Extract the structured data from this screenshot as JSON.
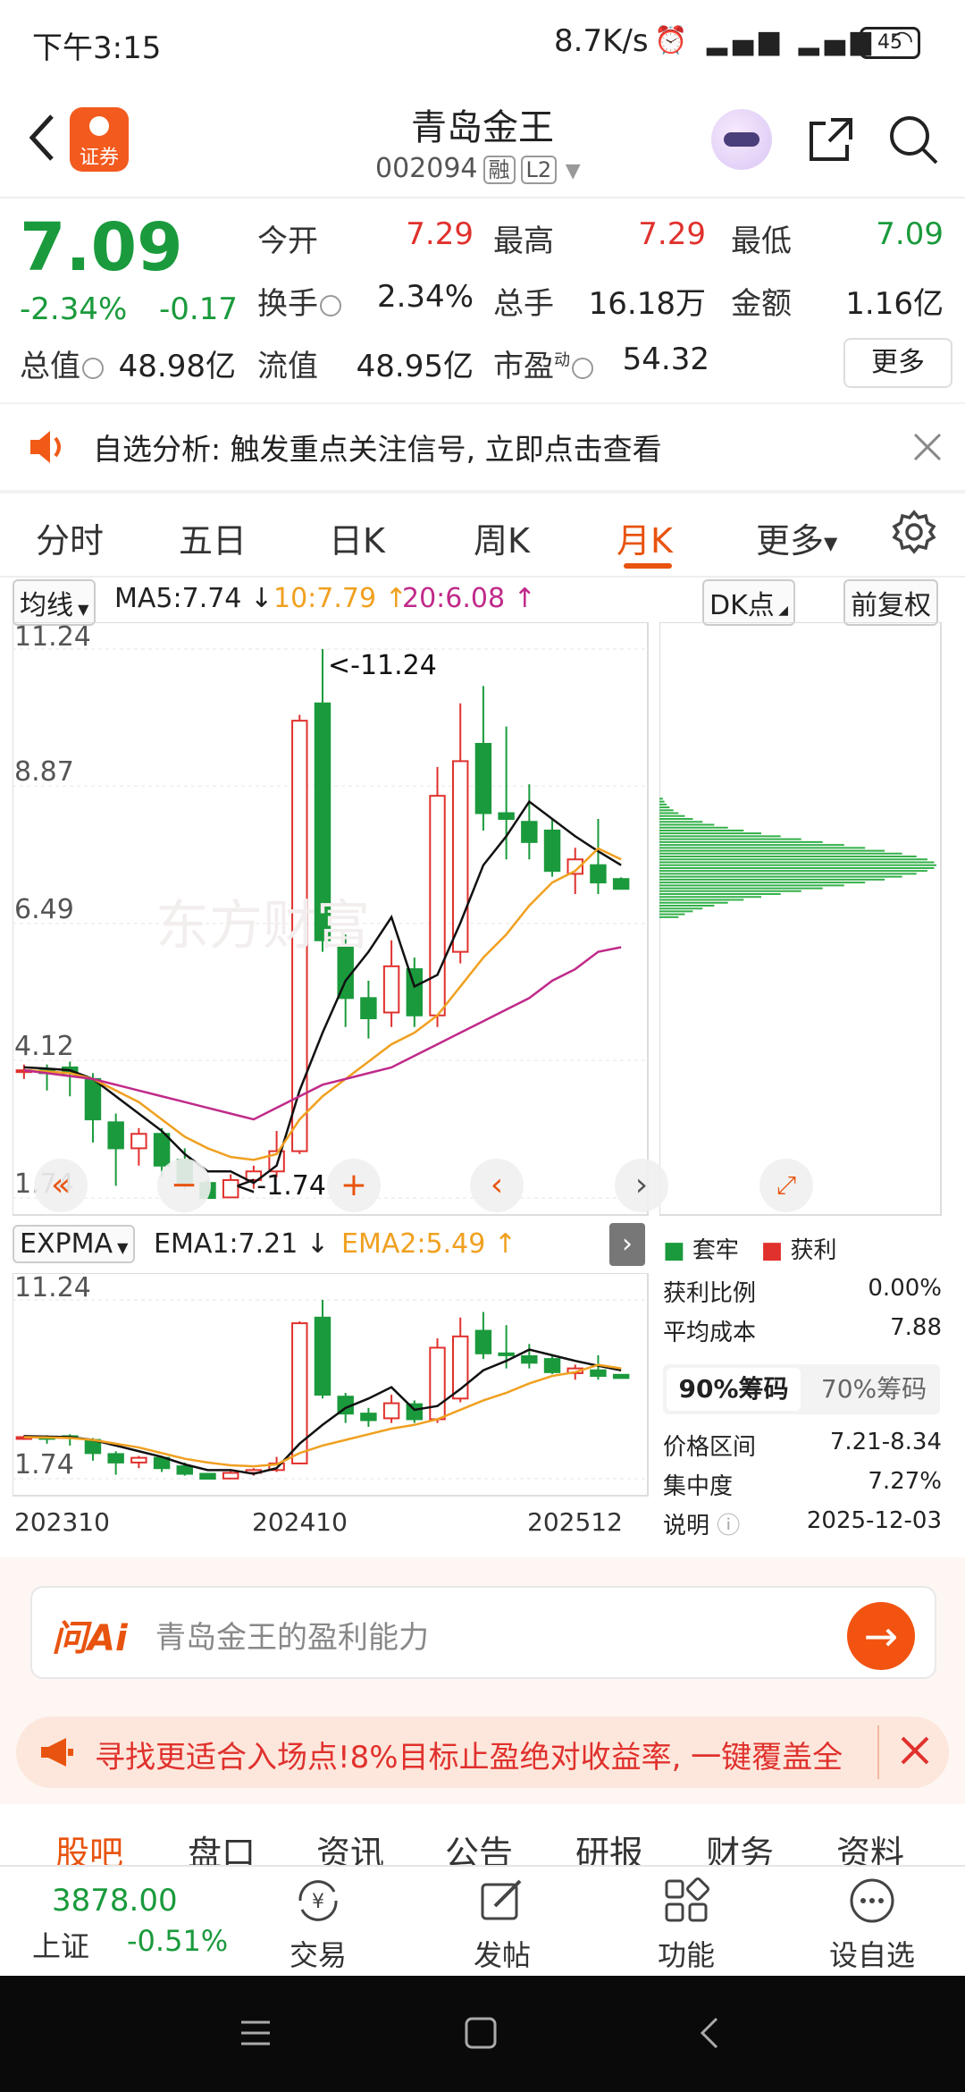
{
  "status": {
    "time": "下午3:15",
    "speed": "8.7K/s",
    "signal": "HD HD",
    "battery": "45"
  },
  "header": {
    "name": "青岛金王",
    "code": "002094",
    "badge1": "融",
    "badge2": "L2",
    "logo_text": "证券"
  },
  "quote": {
    "price": "7.09",
    "change_pct": "-2.34%",
    "change": "-0.17",
    "open_label": "今开",
    "open": "7.29",
    "high_label": "最高",
    "high": "7.29",
    "low_label": "最低",
    "low": "7.09",
    "turnover_label": "换手",
    "turnover": "2.34%",
    "volume_label": "总手",
    "volume": "16.18万",
    "amount_label": "金额",
    "amount": "1.16亿",
    "mcap_label": "总值",
    "mcap": "48.98亿",
    "float_label": "流值",
    "float": "48.95亿",
    "pe_label": "市盈",
    "pe_sup": "动",
    "pe": "54.32",
    "more": "更多"
  },
  "notice": {
    "text": "自选分析: 触发重点关注信号, 立即点击查看"
  },
  "tabs": [
    {
      "label": "分时"
    },
    {
      "label": "五日"
    },
    {
      "label": "日K"
    },
    {
      "label": "周K"
    },
    {
      "label": "月K"
    },
    {
      "label": "更多"
    }
  ],
  "chart": {
    "ma_select": "均线",
    "ma5": "MA5:7.74",
    "ma10": "10:7.79",
    "ma20": "20:6.08",
    "dk_select": "DK点",
    "adjust": "前复权",
    "y_ticks": [
      "11.24",
      "8.87",
      "6.49",
      "4.12",
      "1.74"
    ],
    "hi_mark": "<-11.24",
    "lo_mark": "<-1.74",
    "watermark": "东方财富",
    "expma_select": "EXPMA",
    "ema1": "EMA1:7.21",
    "ema2": "EMA2:5.49",
    "sub_y_ticks": [
      "11.24",
      "1.74"
    ],
    "x_labels": [
      "202310",
      "202410",
      "202512"
    ]
  },
  "chart_data": {
    "type": "candlestick",
    "title": "",
    "ylim": [
      1.74,
      11.24
    ],
    "candles": [
      {
        "o": 3.95,
        "c": 3.95,
        "h": 4.05,
        "l": 3.8
      },
      {
        "o": 3.95,
        "c": 3.9,
        "h": 4.05,
        "l": 3.6
      },
      {
        "o": 4.0,
        "c": 3.9,
        "h": 4.1,
        "l": 3.5
      },
      {
        "o": 3.8,
        "c": 3.1,
        "h": 3.9,
        "l": 2.7
      },
      {
        "o": 3.05,
        "c": 2.6,
        "h": 3.2,
        "l": 1.95
      },
      {
        "o": 2.6,
        "c": 2.85,
        "h": 2.95,
        "l": 2.3
      },
      {
        "o": 2.85,
        "c": 2.3,
        "h": 2.95,
        "l": 2.1
      },
      {
        "o": 2.4,
        "c": 2.0,
        "h": 2.6,
        "l": 1.9
      },
      {
        "o": 2.0,
        "c": 1.74,
        "h": 2.05,
        "l": 1.74
      },
      {
        "o": 1.75,
        "c": 2.05,
        "h": 2.15,
        "l": 1.74
      },
      {
        "o": 2.05,
        "c": 2.2,
        "h": 2.3,
        "l": 1.9
      },
      {
        "o": 2.2,
        "c": 2.55,
        "h": 2.9,
        "l": 2.1
      },
      {
        "o": 2.55,
        "c": 10.0,
        "h": 10.1,
        "l": 2.5
      },
      {
        "o": 10.3,
        "c": 6.2,
        "h": 11.24,
        "l": 6.0
      },
      {
        "o": 6.1,
        "c": 5.2,
        "h": 6.3,
        "l": 4.7
      },
      {
        "o": 5.2,
        "c": 4.85,
        "h": 5.5,
        "l": 4.5
      },
      {
        "o": 4.95,
        "c": 5.75,
        "h": 6.2,
        "l": 4.7
      },
      {
        "o": 5.7,
        "c": 4.9,
        "h": 5.9,
        "l": 4.7
      },
      {
        "o": 4.9,
        "c": 8.7,
        "h": 9.2,
        "l": 4.7
      },
      {
        "o": 6.0,
        "c": 9.3,
        "h": 10.3,
        "l": 5.8
      },
      {
        "o": 9.6,
        "c": 8.4,
        "h": 10.6,
        "l": 8.1
      },
      {
        "o": 8.4,
        "c": 8.3,
        "h": 9.9,
        "l": 7.6
      },
      {
        "o": 8.25,
        "c": 7.9,
        "h": 8.9,
        "l": 7.6
      },
      {
        "o": 8.1,
        "c": 7.4,
        "h": 8.3,
        "l": 7.3
      },
      {
        "o": 7.35,
        "c": 7.6,
        "h": 7.8,
        "l": 7.0
      },
      {
        "o": 7.5,
        "c": 7.2,
        "h": 8.3,
        "l": 7.0
      },
      {
        "o": 7.26,
        "c": 7.09,
        "h": 7.29,
        "l": 7.09
      }
    ],
    "ma5": [
      4.0,
      3.98,
      3.95,
      3.8,
      3.5,
      3.2,
      2.9,
      2.5,
      2.2,
      2.2,
      2.0,
      2.3,
      3.6,
      4.6,
      5.5,
      6.0,
      6.6,
      5.4,
      5.6,
      6.5,
      7.5,
      8.0,
      8.6,
      8.3,
      8.0,
      7.74,
      7.5
    ],
    "ma10": [
      3.95,
      3.93,
      3.9,
      3.8,
      3.6,
      3.4,
      3.1,
      2.8,
      2.6,
      2.45,
      2.4,
      2.5,
      3.1,
      3.5,
      3.8,
      4.1,
      4.4,
      4.6,
      4.9,
      5.4,
      5.9,
      6.3,
      6.8,
      7.2,
      7.4,
      7.79,
      7.6
    ],
    "ma20": [
      3.95,
      3.9,
      3.85,
      3.8,
      3.7,
      3.6,
      3.5,
      3.4,
      3.3,
      3.2,
      3.1,
      3.3,
      3.5,
      3.7,
      3.8,
      3.9,
      4.0,
      4.2,
      4.4,
      4.6,
      4.8,
      5.0,
      5.2,
      5.5,
      5.7,
      6.0,
      6.08
    ]
  },
  "chips": {
    "legend_trapped": "套牢",
    "legend_profit": "获利",
    "profit_ratio_label": "获利比例",
    "profit_ratio": "0.00%",
    "avg_cost_label": "平均成本",
    "avg_cost": "7.88",
    "tab90": "90%筹码",
    "tab70": "70%筹码",
    "range_label": "价格区间",
    "range": "7.21-8.34",
    "conc_label": "集中度",
    "conc": "7.27%",
    "note_label": "说明",
    "note_date": "2025-12-03"
  },
  "ai": {
    "logo": "问Ai",
    "placeholder": "青岛金王的盈利能力"
  },
  "promo": {
    "text": "寻找更适合入场点!8%目标止盈绝对收益率, 一键覆盖全"
  },
  "subtabs": [
    "股吧",
    "盘口",
    "资讯",
    "公告",
    "研报",
    "财务",
    "资料"
  ],
  "bottom": {
    "index_value": "3878.00",
    "index_name": "上证",
    "index_change": "-0.51%",
    "trade": "交易",
    "post": "发帖",
    "func": "功能",
    "fav": "设自选"
  },
  "colors": {
    "up": "#e0312d",
    "down": "#1a9a3c",
    "accent": "#e8530f"
  }
}
